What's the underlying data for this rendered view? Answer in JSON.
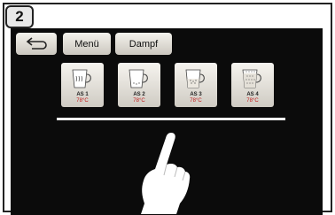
{
  "step": {
    "number": "2"
  },
  "toolbar": {
    "back_icon": "back-arrow-icon",
    "menu_label": "Menü",
    "steam_label": "Dampf"
  },
  "recipes": [
    {
      "icon": "cup-steam-icon",
      "name": "AS 1",
      "temp": "78°C"
    },
    {
      "icon": "cup-foam-icon",
      "name": "AS 2",
      "temp": "78°C"
    },
    {
      "icon": "cup-milk-icon",
      "name": "AS 3",
      "temp": "78°C"
    },
    {
      "icon": "cup-full-icon",
      "name": "AS 4",
      "temp": "78°C"
    }
  ],
  "gesture": {
    "icon": "pointing-hand-icon"
  },
  "colors": {
    "screen": "#0b0b0b",
    "button": "#e6e3dc",
    "temp": "#c01818",
    "scroll_indicator": "#f2f2f2"
  }
}
